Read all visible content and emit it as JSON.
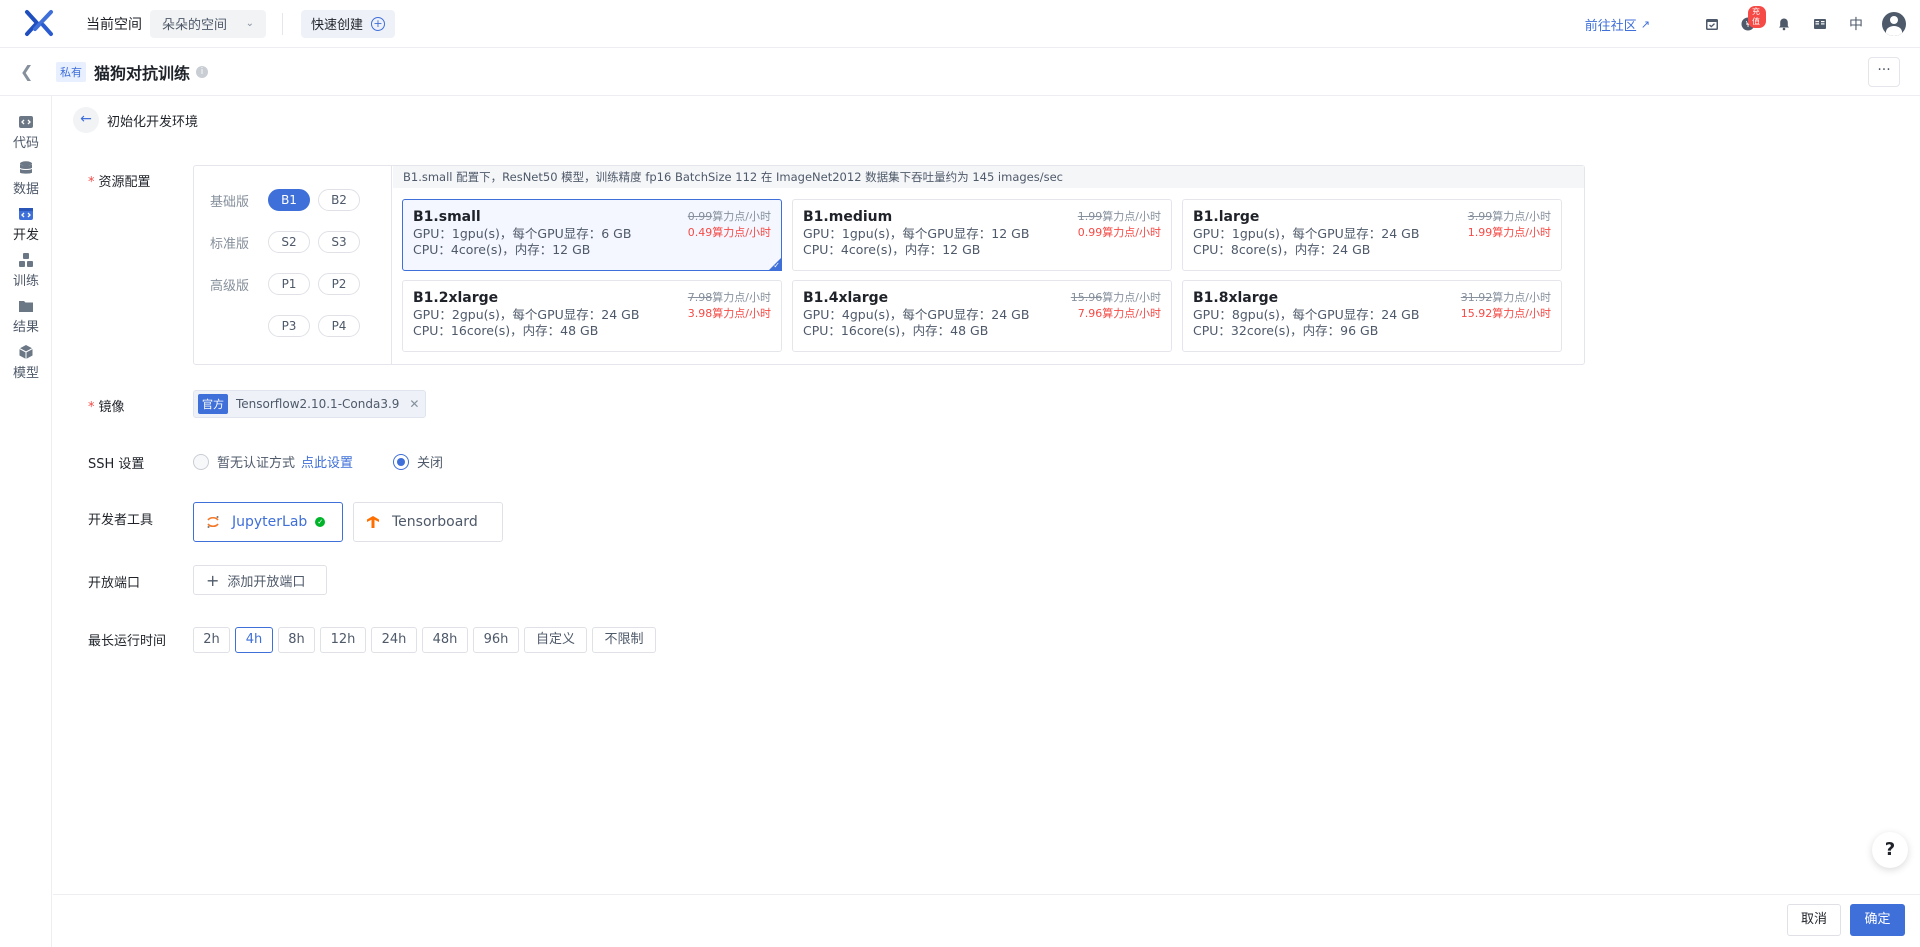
{
  "topbar": {
    "space_label": "当前空间",
    "space_value": "朵朵的空间",
    "quick_create": "快速创建",
    "community": "前往社区",
    "badge": "充值",
    "lang": "中"
  },
  "project": {
    "visibility": "私有",
    "title": "猫狗对抗训练"
  },
  "nav": {
    "items": [
      {
        "label": "代码",
        "icon": "code-icon"
      },
      {
        "label": "数据",
        "icon": "database-icon"
      },
      {
        "label": "开发",
        "icon": "develop-icon"
      },
      {
        "label": "训练",
        "icon": "train-icon"
      },
      {
        "label": "结果",
        "icon": "folder-icon"
      },
      {
        "label": "模型",
        "icon": "cube-icon"
      }
    ],
    "active": "开发"
  },
  "breadcrumb": "初始化开发环境",
  "resource": {
    "label": "资源配置",
    "tiers": [
      {
        "name": "基础版",
        "options": [
          "B1",
          "B2"
        ]
      },
      {
        "name": "标准版",
        "options": [
          "S2",
          "S3"
        ]
      },
      {
        "name": "高级版",
        "options": [
          "P1",
          "P2"
        ]
      },
      {
        "name": "",
        "options": [
          "P3",
          "P4"
        ]
      }
    ],
    "selected_tier_option": "B1",
    "description": "B1.small 配置下，ResNet50 模型，训练精度 fp16 BatchSize 112 在 ImageNet2012 数据集下吞吐量约为 145 images/sec",
    "specs": [
      {
        "name": "B1.small",
        "gpu": "GPU：1gpu(s)，每个GPU显存：6 GB",
        "cpu": "CPU：4core(s)，内存：12 GB",
        "old_price": "0.99",
        "new_price": "0.49",
        "unit": "算力点/小时",
        "selected": true
      },
      {
        "name": "B1.medium",
        "gpu": "GPU：1gpu(s)，每个GPU显存：12 GB",
        "cpu": "CPU：4core(s)，内存：12 GB",
        "old_price": "1.99",
        "new_price": "0.99",
        "unit": "算力点/小时",
        "selected": false
      },
      {
        "name": "B1.large",
        "gpu": "GPU：1gpu(s)，每个GPU显存：24 GB",
        "cpu": "CPU：8core(s)，内存：24 GB",
        "old_price": "3.99",
        "new_price": "1.99",
        "unit": "算力点/小时",
        "selected": false
      },
      {
        "name": "B1.2xlarge",
        "gpu": "GPU：2gpu(s)，每个GPU显存：24 GB",
        "cpu": "CPU：16core(s)，内存：48 GB",
        "old_price": "7.98",
        "new_price": "3.98",
        "unit": "算力点/小时",
        "selected": false
      },
      {
        "name": "B1.4xlarge",
        "gpu": "GPU：4gpu(s)，每个GPU显存：24 GB",
        "cpu": "CPU：16core(s)，内存：48 GB",
        "old_price": "15.96",
        "new_price": "7.96",
        "unit": "算力点/小时",
        "selected": false
      },
      {
        "name": "B1.8xlarge",
        "gpu": "GPU：8gpu(s)，每个GPU显存：24 GB",
        "cpu": "CPU：32core(s)，内存：96 GB",
        "old_price": "31.92",
        "new_price": "15.92",
        "unit": "算力点/小时",
        "selected": false
      }
    ]
  },
  "image": {
    "label": "镜像",
    "tag": "官方",
    "name": "Tensorflow2.10.1-Conda3.9"
  },
  "ssh": {
    "label": "SSH 设置",
    "option1": "暂无认证方式",
    "option1_link": "点此设置",
    "option2": "关闭",
    "selected": "关闭"
  },
  "devtools": {
    "label": "开发者工具",
    "tools": [
      {
        "name": "JupyterLab",
        "selected": true
      },
      {
        "name": "Tensorboard",
        "selected": false
      }
    ]
  },
  "ports": {
    "label": "开放端口",
    "add_button": "添加开放端口"
  },
  "runtime": {
    "label": "最长运行时间",
    "options": [
      "2h",
      "4h",
      "8h",
      "12h",
      "24h",
      "48h",
      "96h",
      "自定义",
      "不限制"
    ],
    "selected": "4h"
  },
  "footer": {
    "cancel": "取消",
    "confirm": "确定"
  },
  "colors": {
    "accent": "#3f6fd8",
    "price_red": "#f54a45",
    "success": "#00b42a"
  }
}
